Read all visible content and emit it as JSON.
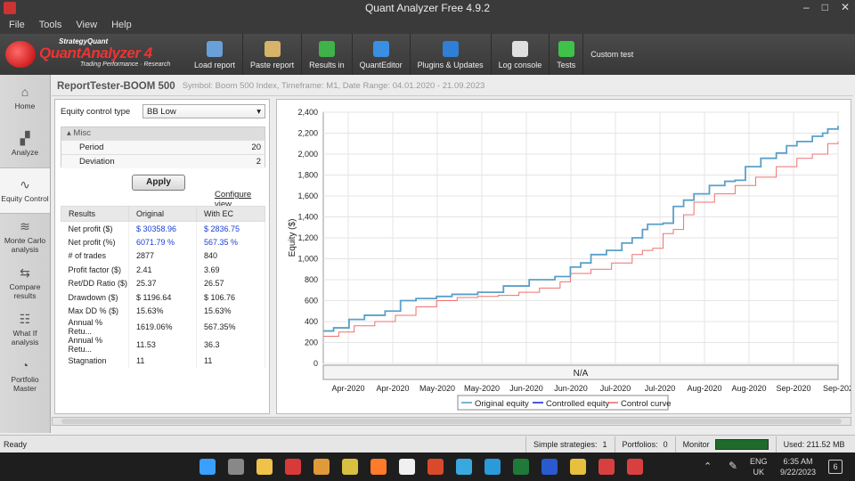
{
  "window": {
    "title": "Quant Analyzer Free 4.9.2",
    "controls": [
      "–",
      "□",
      "✕"
    ]
  },
  "menu": [
    "File",
    "Tools",
    "View",
    "Help"
  ],
  "logo": {
    "brand": "StrategyQuant",
    "name": "QuantAnalyzer 4",
    "tagline": "Trading Performance · Research"
  },
  "toolbar": [
    {
      "label": "Load report",
      "icon": "folder-icon",
      "color": "#6aa0d8"
    },
    {
      "label": "Paste report",
      "icon": "clipboard-icon",
      "color": "#d8b46a"
    },
    {
      "label": "Results in",
      "icon": "dollar-icon",
      "color": "#3fb24a"
    },
    {
      "label": "QuantEditor",
      "icon": "globe-icon",
      "color": "#3a8fe0"
    },
    {
      "label": "Plugins & Updates",
      "icon": "puzzle-icon",
      "color": "#2f7fd6"
    },
    {
      "label": "Log console",
      "icon": "console-icon",
      "color": "#e0e0e0"
    },
    {
      "label": "Tests",
      "icon": "check-icon",
      "color": "#3fc24a"
    }
  ],
  "toolbar_custom": "Custom test",
  "sidebar": [
    {
      "label": "Home",
      "icon": "bank-icon"
    },
    {
      "label": "Analyze",
      "icon": "chart-icon"
    },
    {
      "label": "Equity Control",
      "icon": "equity-icon",
      "active": true
    },
    {
      "label": "Monte Carlo analysis",
      "icon": "montecarlo-icon"
    },
    {
      "label": "Compare results",
      "icon": "compare-icon"
    },
    {
      "label": "What If analysis",
      "icon": "whatif-icon"
    },
    {
      "label": "Portfolio Master",
      "icon": "pie-icon"
    }
  ],
  "report": {
    "title": "ReportTester-BOOM 500",
    "subtitle": "Symbol: Boom 500 Index, Timeframe: M1, Date Range: 04.01.2020 - 21.09.2023"
  },
  "equity_control": {
    "label": "Equity control type",
    "value": "BB Low",
    "misc_header": "Misc",
    "params": [
      {
        "name": "Period",
        "value": "20"
      },
      {
        "name": "Deviation",
        "value": "2"
      }
    ],
    "apply": "Apply",
    "configure": "Configure view"
  },
  "results": {
    "headers": [
      "Results",
      "Original",
      "With EC"
    ],
    "rows": [
      {
        "name": "Net profit ($)",
        "orig": "$ 30358.96",
        "ec": "$ 2836.75",
        "blue": true
      },
      {
        "name": "Net profit (%)",
        "orig": "6071.79 %",
        "ec": "567.35 %",
        "blue": true
      },
      {
        "name": "# of trades",
        "orig": "2877",
        "ec": "840"
      },
      {
        "name": "Profit factor ($)",
        "orig": "2.41",
        "ec": "3.69"
      },
      {
        "name": "Ret/DD Ratio ($)",
        "orig": "25.37",
        "ec": "26.57"
      },
      {
        "name": "Drawdown ($)",
        "orig": "$ 1196.64",
        "ec": "$ 106.76"
      },
      {
        "name": "Max DD % ($)",
        "orig": "15.63%",
        "ec": "15.63%"
      },
      {
        "name": "Annual % Retu...",
        "orig": "1619.06%",
        "ec": "567.35%"
      },
      {
        "name": "Annual % Retu...",
        "orig": "11.53",
        "ec": "36.3"
      },
      {
        "name": "Stagnation",
        "orig": "11",
        "ec": "11"
      }
    ]
  },
  "chart_data": {
    "type": "line",
    "ylabel": "Equity ($)",
    "xlabel": "N/A",
    "ylim": [
      0,
      2400
    ],
    "yticks": [
      "0",
      "200",
      "400",
      "600",
      "800",
      "1,000",
      "1,200",
      "1,400",
      "1,600",
      "1,800",
      "2,000",
      "2,200",
      "2,400"
    ],
    "xticks": [
      "Apr-2020",
      "Apr-2020",
      "May-2020",
      "May-2020",
      "Jun-2020",
      "Jun-2020",
      "Jul-2020",
      "Jul-2020",
      "Aug-2020",
      "Aug-2020",
      "Sep-2020",
      "Sep-202"
    ],
    "grid": true,
    "legend": "bottom",
    "series": [
      {
        "name": "Original equity",
        "color": "#5aa0c8",
        "x": [
          0,
          2,
          5,
          8,
          12,
          15,
          18,
          22,
          25,
          30,
          35,
          40,
          45,
          48,
          50,
          52,
          55,
          58,
          60,
          62,
          63,
          66,
          68,
          70,
          72,
          75,
          78,
          80,
          82,
          85,
          88,
          90,
          92,
          95,
          97,
          98,
          100
        ],
        "values": [
          310,
          340,
          420,
          460,
          500,
          600,
          620,
          640,
          660,
          680,
          740,
          800,
          830,
          920,
          960,
          1040,
          1080,
          1150,
          1200,
          1280,
          1330,
          1340,
          1500,
          1560,
          1620,
          1700,
          1740,
          1750,
          1880,
          1960,
          2010,
          2080,
          2120,
          2170,
          2200,
          2240,
          2270
        ]
      },
      {
        "name": "Controlled equity",
        "color": "#1c2fd0",
        "x": [
          0,
          100
        ],
        "values": [
          300,
          2270
        ]
      },
      {
        "name": "Control curve",
        "color": "#f07070",
        "x": [
          0,
          3,
          6,
          10,
          14,
          18,
          22,
          26,
          30,
          34,
          38,
          42,
          46,
          48,
          52,
          56,
          60,
          62,
          64,
          66,
          68,
          70,
          72,
          76,
          80,
          84,
          88,
          92,
          95,
          98,
          100
        ],
        "values": [
          260,
          300,
          360,
          400,
          460,
          540,
          600,
          630,
          640,
          650,
          680,
          720,
          780,
          860,
          900,
          960,
          1040,
          1080,
          1100,
          1240,
          1280,
          1420,
          1540,
          1620,
          1700,
          1780,
          1880,
          1960,
          2000,
          2100,
          2120
        ]
      }
    ]
  },
  "status": {
    "ready": "Ready",
    "simple_label": "Simple strategies:",
    "simple_value": "1",
    "portfolios_label": "Portfolios:",
    "portfolios_value": "0",
    "monitor": "Monitor",
    "used": "Used: 211.52 MB"
  },
  "taskbar": {
    "lang1": "ENG",
    "lang2": "UK",
    "time": "6:35 AM",
    "date": "9/22/2023",
    "notif": "6",
    "apps": [
      {
        "name": "windows-start-icon",
        "color": "#3aa0ff"
      },
      {
        "name": "taskview-icon",
        "color": "#888888"
      },
      {
        "name": "file-explorer-icon",
        "color": "#f0c24a"
      },
      {
        "name": "media-app-icon",
        "color": "#d83a3a"
      },
      {
        "name": "tool-app-icon",
        "color": "#e09a3a"
      },
      {
        "name": "store-app-icon",
        "color": "#d8c040"
      },
      {
        "name": "firefox-icon",
        "color": "#ff7a2a"
      },
      {
        "name": "tradingview-icon",
        "color": "#f0f0f0"
      },
      {
        "name": "office-icon",
        "color": "#d84a2a"
      },
      {
        "name": "telegram-icon",
        "color": "#3aa8e0"
      },
      {
        "name": "edge-icon",
        "color": "#2a9ad8"
      },
      {
        "name": "excel-icon",
        "color": "#1f7a3a"
      },
      {
        "name": "word-icon",
        "color": "#2a5ad0"
      },
      {
        "name": "notes-app-icon",
        "color": "#e8c040"
      },
      {
        "name": "quantanalyzer-app-icon",
        "color": "#d84040"
      },
      {
        "name": "paint-app-icon",
        "color": "#d84040"
      }
    ]
  }
}
